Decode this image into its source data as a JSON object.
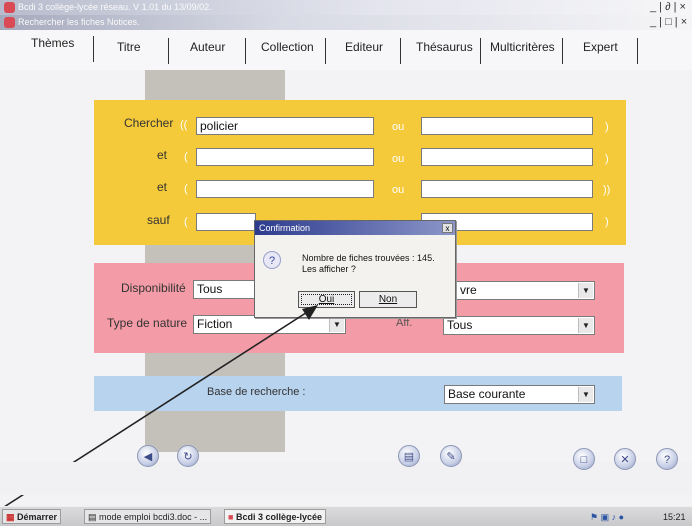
{
  "window": {
    "title": "Bcdi 3 collège-lycée réseau. V 1.01 du 13/09/02.",
    "subtitle": "Rechercher les fiches Notices.",
    "controls": "_ | ∂ | ×",
    "subcontrols": "_ | □ | ×"
  },
  "tabs": [
    "Thèmes",
    "Titre",
    "Auteur",
    "Collection",
    "Editeur",
    "Thésaurus",
    "Multicritères",
    "Expert"
  ],
  "search": {
    "rows": [
      {
        "label": "Chercher",
        "open": "((",
        "value": "policier",
        "op": "ou",
        "value2": "",
        "close": ")"
      },
      {
        "label": "et",
        "open": "(",
        "value": "",
        "op": "ou",
        "value2": "",
        "close": ")"
      },
      {
        "label": "et",
        "open": "(",
        "value": "",
        "op": "ou",
        "value2": "",
        "close": "))"
      },
      {
        "label": "sauf",
        "open": "(",
        "value": "",
        "op": "ou",
        "value2": "",
        "close": ")"
      }
    ]
  },
  "filters": {
    "disponibilite_label": "Disponibilité",
    "disponibilite_value": "Tous",
    "right_top_value": "vre",
    "type_label": "Type de nature",
    "type_value": "Fiction",
    "right_bottom_label": "Aff.",
    "right_bottom_value": "Tous"
  },
  "base": {
    "label": "Base de recherche :",
    "value": "Base courante"
  },
  "dialog": {
    "title": "Confirmation",
    "close": "x",
    "icon": "?",
    "line1": "Nombre de fiches trouvées :  145.",
    "line2": "Les afficher ?",
    "ok": "Oui",
    "cancel": "Non"
  },
  "taskbar": {
    "start": "Démarrer",
    "item1": "mode emploi bcdi3.doc - ...",
    "item2": "Bcdi 3 collège-lycée",
    "clock": "15:21"
  },
  "colors": {
    "yellow_panel": "#f4c93a",
    "pink_panel": "#f39ba6",
    "blue_panel": "#b7d3ee",
    "dialog_title": "#2d3b8e"
  }
}
